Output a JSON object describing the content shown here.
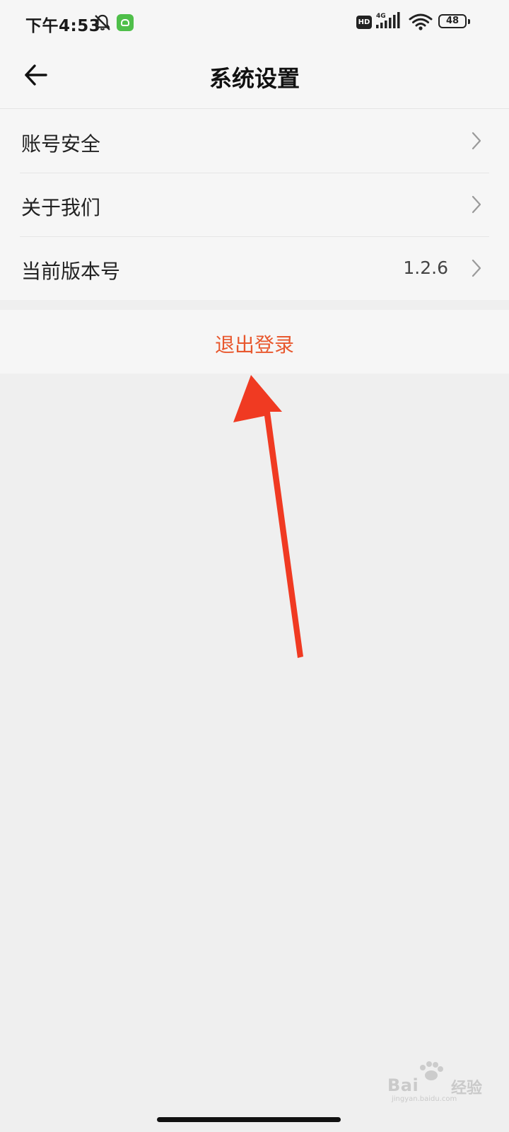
{
  "status_bar": {
    "time": "下午4:53",
    "hd_label": "HD",
    "network_label": "4G",
    "battery_level": "48"
  },
  "header": {
    "title": "系统设置",
    "back_icon": "arrow-left-icon"
  },
  "settings": {
    "items": [
      {
        "label": "账号安全",
        "value": ""
      },
      {
        "label": "关于我们",
        "value": ""
      },
      {
        "label": "当前版本号",
        "value": "1.2.6"
      }
    ]
  },
  "logout": {
    "label": "退出登录"
  },
  "annotation": {
    "type": "arrow",
    "color": "#f03a22"
  },
  "watermark": {
    "brand": "Bai",
    "text": "经验",
    "url": "jingyan.baidu.com"
  },
  "colors": {
    "accent": "#e8582e",
    "background": "#efefef",
    "surface": "#f6f6f6"
  }
}
